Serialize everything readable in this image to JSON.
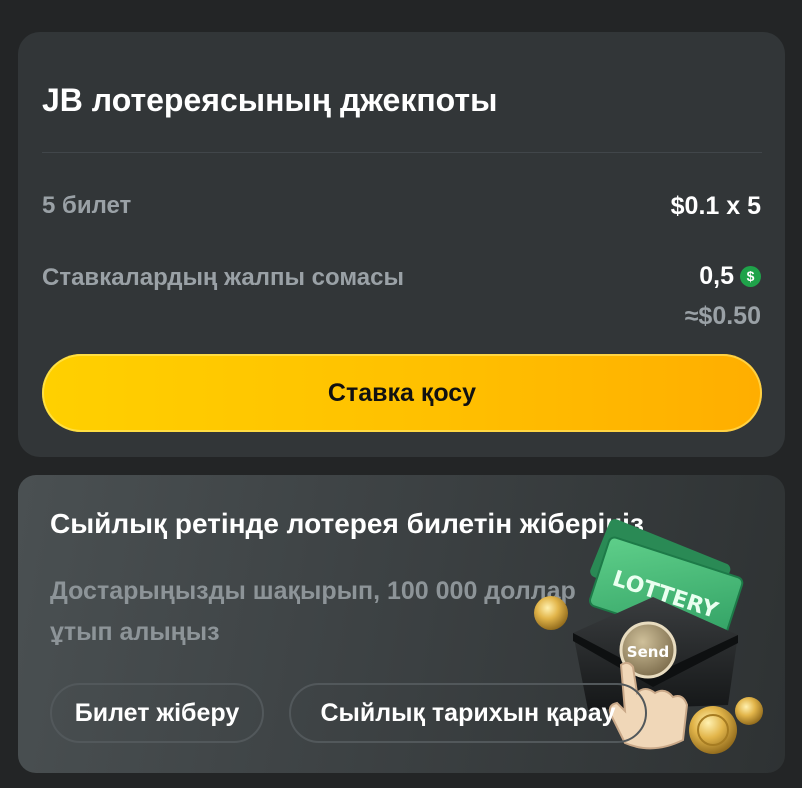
{
  "jackpot": {
    "title": "JB лотереясының джекпоты",
    "tickets_label": "5 билет",
    "tickets_value": "$0.1 x 5",
    "total_label": "Ставкалардың жалпы сомасы",
    "total_value": "0,5",
    "coin_symbol": "$",
    "total_approx": "≈$0.50",
    "bet_button": "Ставка қосу"
  },
  "gift": {
    "title": "Сыйлық ретінде лотерея билетін жіберіңіз",
    "description": "Достарыңызды шақырып, 100 000 доллар ұтып алыңыз",
    "send_button": "Билет жіберу",
    "history_button": "Сыйлық тарихын қарау",
    "illustration": {
      "ticket_text": "LOTTERY",
      "send_text": "Send"
    }
  },
  "colors": {
    "background": "#232526",
    "card": "#323638",
    "accent_yellow": "#ffc000",
    "coin_green": "#1fa34a",
    "ticket_green": "#2f9e62"
  }
}
